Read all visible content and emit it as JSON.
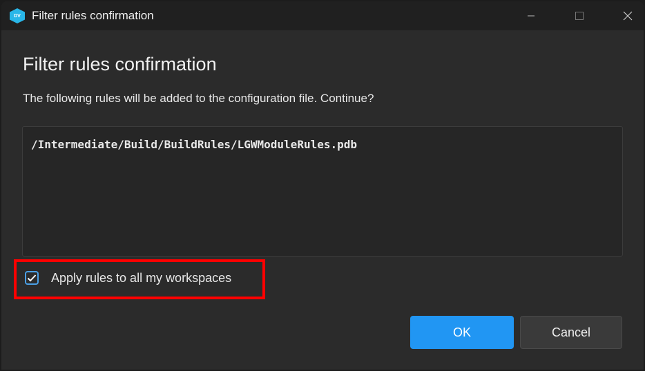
{
  "window": {
    "title": "Filter rules confirmation",
    "app_icon_text": "DV"
  },
  "dialog": {
    "heading": "Filter rules confirmation",
    "message": "The following rules will be added to the configuration file. Continue?",
    "rules": [
      "/Intermediate/Build/BuildRules/LGWModuleRules.pdb"
    ],
    "apply_all": {
      "label": "Apply rules to all my workspaces",
      "checked": true
    },
    "ok_label": "OK",
    "cancel_label": "Cancel"
  },
  "colors": {
    "accent": "#2196f3",
    "highlight": "#ff0000"
  }
}
